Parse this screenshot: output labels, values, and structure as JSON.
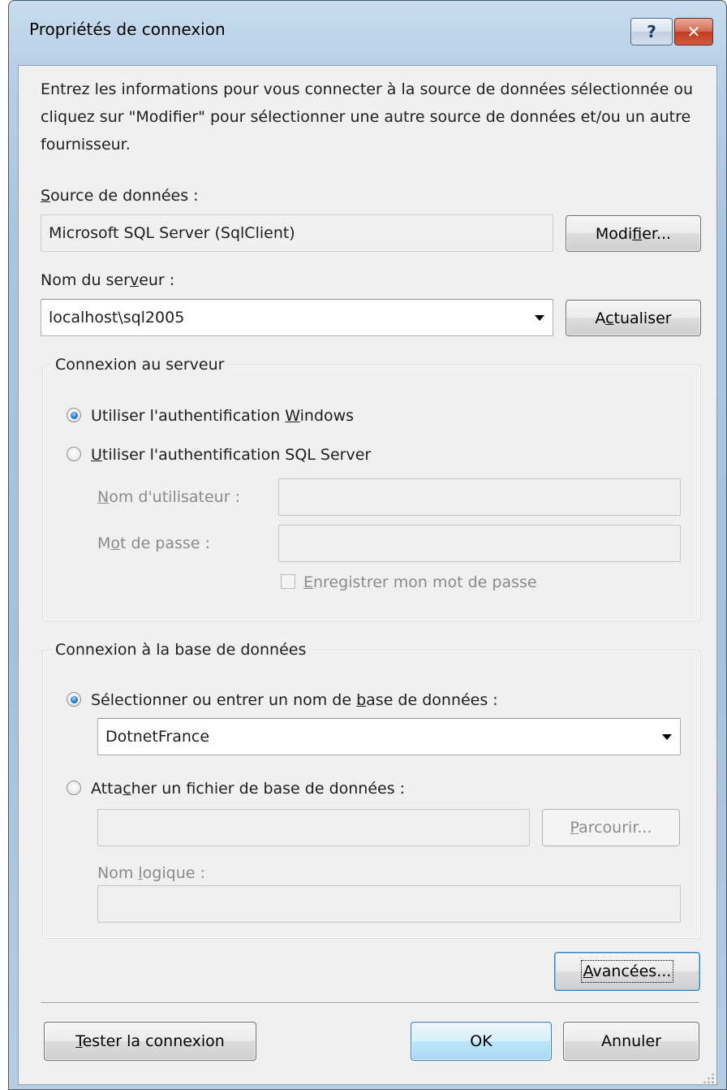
{
  "window": {
    "title": "Propriétés de connexion",
    "help_glyph": "?",
    "close_glyph": "✕"
  },
  "intro_text": "Entrez les informations pour vous connecter à la source de données sélectionnée ou cliquez sur \"Modifier\" pour sélectionner une autre source de données et/ou un autre fournisseur.",
  "data_source": {
    "label_pre": "",
    "label_key": "S",
    "label_post": "ource de données :",
    "value": "Microsoft SQL Server (SqlClient)",
    "modify_pre": "Modi",
    "modify_key": "f",
    "modify_post": "ier..."
  },
  "server": {
    "label_pre": "Nom du ser",
    "label_key": "v",
    "label_post": "eur :",
    "value": "localhost\\sql2005",
    "refresh_pre": "A",
    "refresh_key": "c",
    "refresh_post": "tualiser"
  },
  "server_logon": {
    "legend": "Connexion au serveur",
    "windows_auth_pre": "Utiliser l'authentification ",
    "windows_auth_key": "W",
    "windows_auth_post": "indows",
    "sql_auth_pre": "",
    "sql_auth_key": "U",
    "sql_auth_post": "tiliser l'authentification SQL Server",
    "username_label_pre": "",
    "username_label_key": "N",
    "username_label_post": "om d'utilisateur :",
    "username_value": "",
    "password_label_pre": "M",
    "password_label_key": "o",
    "password_label_post": "t de passe :",
    "password_value": "",
    "save_password_pre": "",
    "save_password_key": "E",
    "save_password_post": "nregistrer mon mot de passe",
    "selected": "windows"
  },
  "database": {
    "legend": "Connexion à la base de données",
    "select_db_pre": "Sélectionner ou entrer un nom de ",
    "select_db_key": "b",
    "select_db_post": "ase de données :",
    "db_value": "DotnetFrance",
    "attach_pre": "Atta",
    "attach_key": "c",
    "attach_post": "her un fichier de base de données :",
    "attach_path_value": "",
    "browse_pre": "",
    "browse_key": "P",
    "browse_post": "arcourir...",
    "logical_label_pre": "Nom ",
    "logical_label_key": "l",
    "logical_label_post": "ogique :",
    "logical_value": "",
    "selected": "select"
  },
  "advanced_pre": "",
  "advanced_key": "A",
  "advanced_post": "vancées...",
  "test_pre": "",
  "test_key": "T",
  "test_post": "ester la connexion",
  "ok_label": "OK",
  "cancel_label": "Annuler"
}
